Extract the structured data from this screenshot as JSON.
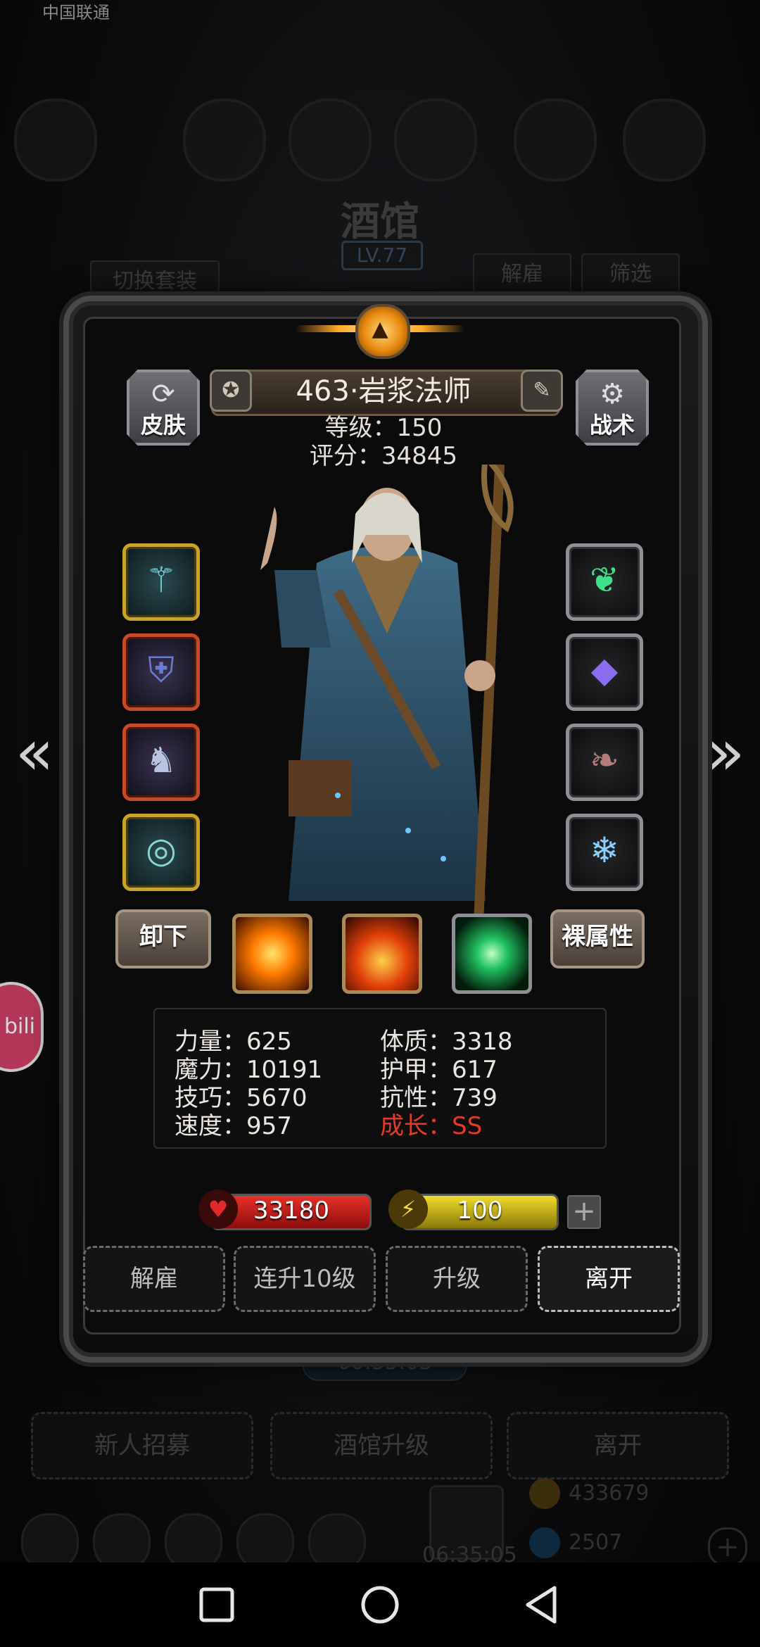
{
  "status_bar": {
    "carrier": "中国联通"
  },
  "background": {
    "title": "酒馆",
    "level": "LV.77",
    "switch_outfit": "切换套装",
    "dismiss": "解雇",
    "filter": "筛选",
    "timer": "00:35:03",
    "bottom_buttons": [
      "新人招募",
      "酒馆升级",
      "离开"
    ],
    "timer2": "06:35:05",
    "gold": "433679",
    "gems": "2507"
  },
  "side_badge": "bili",
  "panel": {
    "skin_label": "皮肤",
    "tactics_label": "战术",
    "hero_name": "463·岩浆法师",
    "level_line": "等级：150",
    "score_line": "评分：34845",
    "unequip_label": "卸下",
    "naked_attr_label": "裸属性",
    "equipment_left": [
      "staff-icon",
      "armor-icon",
      "dragon-helm-icon",
      "ring-icon"
    ],
    "equipment_right": [
      "green-spirit-icon",
      "purple-gem-icon",
      "feather-icon",
      "ice-crystal-icon"
    ],
    "skills": [
      "explosion-skill-icon",
      "fire-skill-icon",
      "green-crystal-skill-icon"
    ],
    "stats_left": [
      "力量：625",
      "魔力：10191",
      "技巧：5670",
      "速度：957"
    ],
    "stats_right": [
      "体质：3318",
      "护甲：617",
      "抗性：739"
    ],
    "growth": "成长：SS",
    "hp": "33180",
    "energy": "100",
    "actions": {
      "dismiss": "解雇",
      "level10": "连升10级",
      "levelup": "升级",
      "leave": "离开"
    }
  },
  "colors": {
    "hp_bar": "#c8181c",
    "energy_bar": "#d9c21c",
    "growth_text": "#e43b21",
    "gold_frame": "#c9a526"
  }
}
